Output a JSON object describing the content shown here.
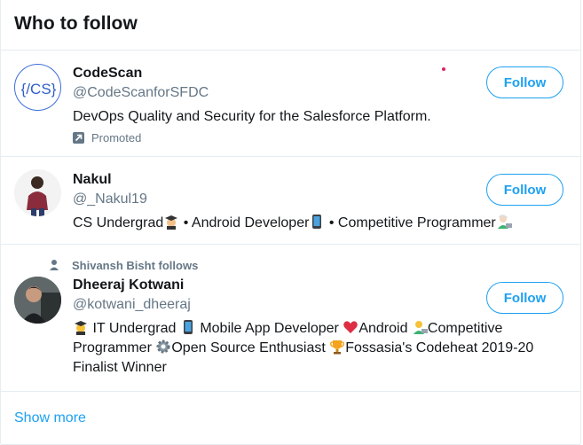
{
  "header": {
    "title": "Who to follow"
  },
  "accounts": [
    {
      "name": "CodeScan",
      "handle": "@CodeScanforSFDC",
      "bio": "DevOps Quality and Security for the Salesforce Platform.",
      "promoted_label": "Promoted",
      "avatar_text": "{/CS}",
      "follow_label": "Follow"
    },
    {
      "name": "Nakul",
      "handle": "@_Nakul19",
      "bio_parts": [
        "CS Undergrad",
        " • Android Developer",
        " • Competitive Programmer"
      ],
      "follow_label": "Follow"
    },
    {
      "social_context": "Shivansh Bisht follows",
      "name": "Dheeraj Kotwani",
      "handle": "@kotwani_dheeraj",
      "bio_parts": [
        " IT Undergrad ",
        " Mobile App Developer ",
        "Android ",
        "Competitive Programmer ",
        "Open Source Enthusiast ",
        "Fossasia's Codeheat 2019-20 Finalist Winner"
      ],
      "follow_label": "Follow"
    }
  ],
  "footer": {
    "show_more": "Show more"
  },
  "colors": {
    "accent": "#1da1f2",
    "secondary_text": "#657786",
    "border": "#e6ecf0"
  }
}
